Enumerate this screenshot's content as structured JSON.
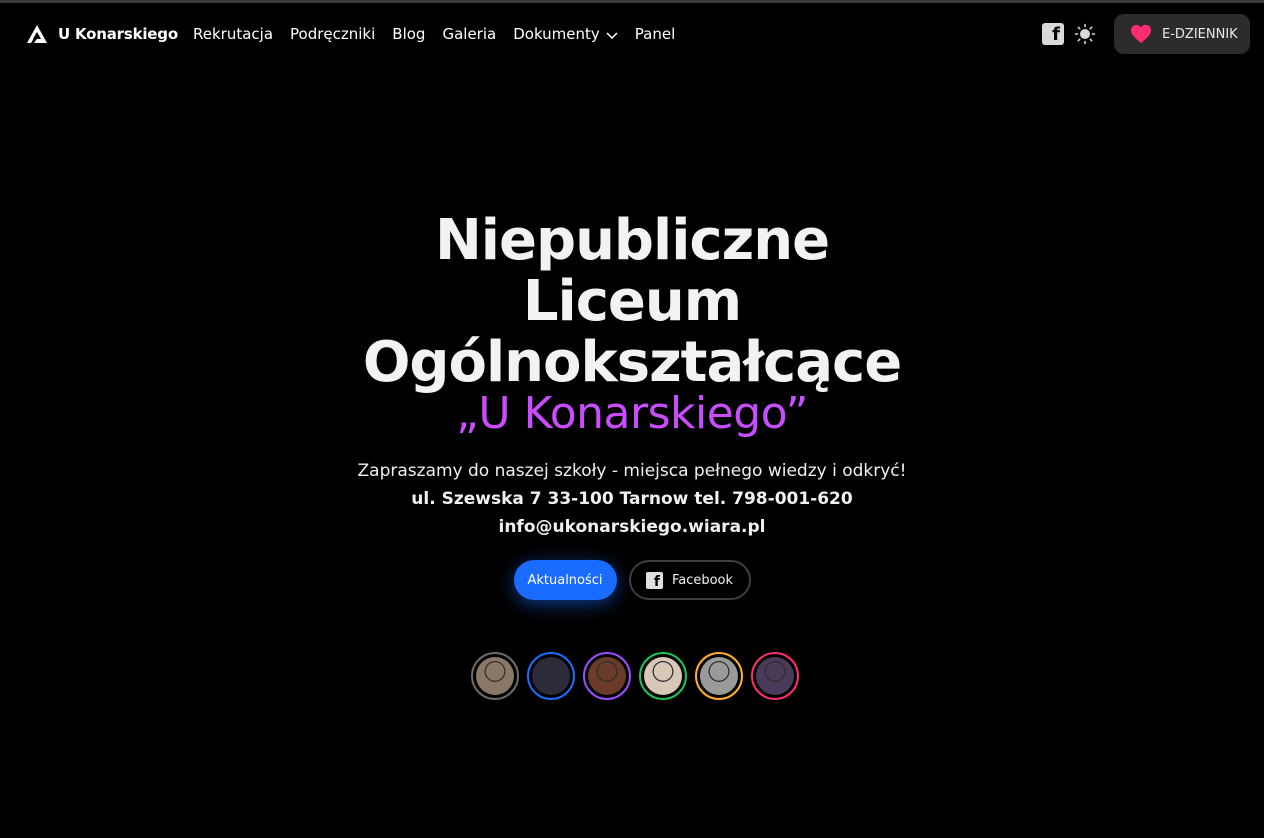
{
  "nav": {
    "brand": "U Konarskiego",
    "items": [
      {
        "label": "Rekrutacja"
      },
      {
        "label": "Podręczniki"
      },
      {
        "label": "Blog"
      },
      {
        "label": "Galeria"
      },
      {
        "label": "Dokumenty",
        "has_dropdown": true
      },
      {
        "label": "Panel"
      }
    ],
    "social_icon": "facebook-icon",
    "theme_icon": "sun-icon",
    "cta_label": "E-DZIENNIK",
    "cta_icon": "heart-icon",
    "cta_icon_color": "#ff2d6f"
  },
  "hero": {
    "title_lines": [
      "Niepubliczne",
      "Liceum",
      "Ogólnokształcące"
    ],
    "title_accent": "„U Konarskiego”",
    "accent_color": "#c94dff",
    "tagline": "Zapraszamy do naszej szkoły - miejsca pełnego wiedzy i odkryć!",
    "address": "ul. Szewska 7 33-100 Tarnow tel. 798-001-620",
    "email": "info@ukonarskiego.wiara.pl",
    "buttons": {
      "primary": "Aktualności",
      "secondary": "Facebook"
    }
  },
  "avatars": [
    {
      "ring": "#6b6b6b",
      "fill": "#8a7766"
    },
    {
      "ring": "#1f6bff",
      "fill": "#2b2b3a"
    },
    {
      "ring": "#9a4dff",
      "fill": "#6a3a2a"
    },
    {
      "ring": "#1fc15a",
      "fill": "#d8c8b8"
    },
    {
      "ring": "#ffb020",
      "fill": "#9a9a9a"
    },
    {
      "ring": "#ff2d6f",
      "fill": "#4a3a5a"
    }
  ]
}
